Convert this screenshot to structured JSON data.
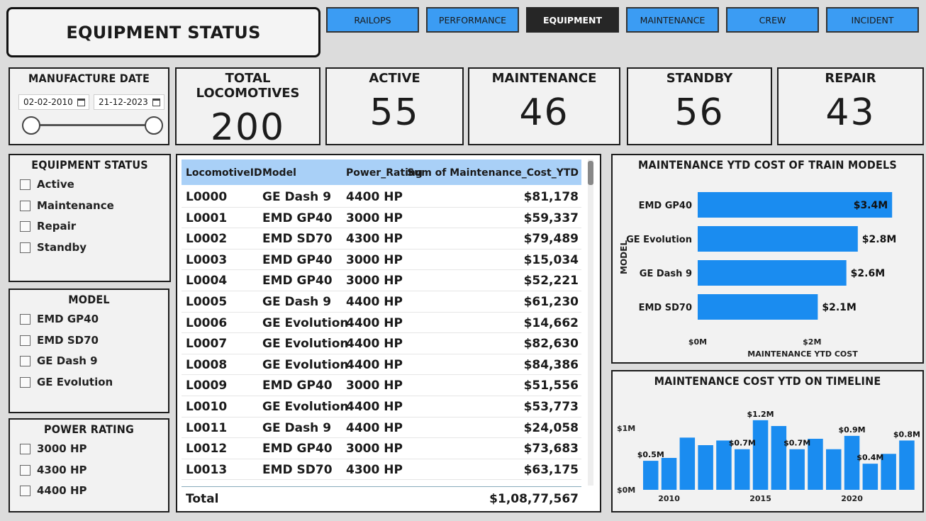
{
  "header": {
    "title": "EQUIPMENT STATUS"
  },
  "nav": [
    {
      "label": "RAILOPS",
      "active": false
    },
    {
      "label": "PERFORMANCE",
      "active": false
    },
    {
      "label": "EQUIPMENT",
      "active": true
    },
    {
      "label": "MAINTENANCE",
      "active": false
    },
    {
      "label": "CREW",
      "active": false
    },
    {
      "label": "INCIDENT",
      "active": false
    }
  ],
  "date_filter": {
    "title": "MANUFACTURE DATE",
    "start": "02-02-2010",
    "end": "21-12-2023"
  },
  "kpis": [
    {
      "label": "TOTAL LOCOMOTIVES",
      "value": "200"
    },
    {
      "label": "ACTIVE",
      "value": "55"
    },
    {
      "label": "MAINTENANCE",
      "value": "46"
    },
    {
      "label": "STANDBY",
      "value": "56"
    },
    {
      "label": "REPAIR",
      "value": "43"
    }
  ],
  "filters": {
    "status": {
      "title": "EQUIPMENT STATUS",
      "options": [
        "Active",
        "Maintenance",
        "Repair",
        "Standby"
      ]
    },
    "model": {
      "title": "MODEL",
      "options": [
        "EMD GP40",
        "EMD SD70",
        "GE Dash 9",
        "GE Evolution"
      ]
    },
    "power": {
      "title": "POWER RATING",
      "options": [
        "3000 HP",
        "4300 HP",
        "4400 HP"
      ]
    }
  },
  "table": {
    "columns": [
      "LocomotiveID",
      "Model",
      "Power_Rating",
      "Sum of Maintenance_Cost_YTD"
    ],
    "rows": [
      [
        "L0000",
        "GE Dash 9",
        "4400 HP",
        "$81,178"
      ],
      [
        "L0001",
        "EMD GP40",
        "3000 HP",
        "$59,337"
      ],
      [
        "L0002",
        "EMD SD70",
        "4300 HP",
        "$79,489"
      ],
      [
        "L0003",
        "EMD GP40",
        "3000 HP",
        "$15,034"
      ],
      [
        "L0004",
        "EMD GP40",
        "3000 HP",
        "$52,221"
      ],
      [
        "L0005",
        "GE Dash 9",
        "4400 HP",
        "$61,230"
      ],
      [
        "L0006",
        "GE Evolution",
        "4400 HP",
        "$14,662"
      ],
      [
        "L0007",
        "GE Evolution",
        "4400 HP",
        "$82,630"
      ],
      [
        "L0008",
        "GE Evolution",
        "4400 HP",
        "$84,386"
      ],
      [
        "L0009",
        "EMD GP40",
        "3000 HP",
        "$51,556"
      ],
      [
        "L0010",
        "GE Evolution",
        "4400 HP",
        "$53,773"
      ],
      [
        "L0011",
        "GE Dash 9",
        "4400 HP",
        "$24,058"
      ],
      [
        "L0012",
        "EMD GP40",
        "3000 HP",
        "$73,683"
      ],
      [
        "L0013",
        "EMD SD70",
        "4300 HP",
        "$63,175"
      ]
    ],
    "total_label": "Total",
    "total_value": "$1,08,77,567"
  },
  "colors": {
    "accent": "#1a8cf0",
    "nav": "#3b9cf3",
    "nav_active": "#262626",
    "table_header": "#a9d0f7"
  },
  "chart_data": [
    {
      "type": "bar",
      "orientation": "horizontal",
      "title": "MAINTENANCE YTD COST OF TRAIN MODELS",
      "xlabel": "MAINTENANCE YTD COST",
      "ylabel": "MODEL",
      "categories": [
        "EMD GP40",
        "GE Evolution",
        "GE Dash 9",
        "EMD SD70"
      ],
      "values": [
        3.4,
        2.8,
        2.6,
        2.1
      ],
      "value_labels": [
        "$3.4M",
        "$2.8M",
        "$2.6M",
        "$2.1M"
      ],
      "xticks": [
        "$0M",
        "$2M"
      ],
      "xlim": [
        0,
        3.5
      ],
      "unit": "$M"
    },
    {
      "type": "bar",
      "title": "MAINTENANCE COST YTD ON TIMELINE",
      "x": [
        2009,
        2010,
        2011,
        2012,
        2013,
        2014,
        2015,
        2016,
        2017,
        2018,
        2019,
        2020,
        2021,
        2022,
        2023
      ],
      "values": [
        0.5,
        0.55,
        0.9,
        0.77,
        0.85,
        0.7,
        1.2,
        1.1,
        0.7,
        0.88,
        0.7,
        0.93,
        0.45,
        0.62,
        0.85
      ],
      "value_labels": [
        {
          "index": 0,
          "text": "$0.5M"
        },
        {
          "index": 5,
          "text": "$0.7M"
        },
        {
          "index": 6,
          "text": "$1.2M"
        },
        {
          "index": 8,
          "text": "$0.7M"
        },
        {
          "index": 11,
          "text": "$0.9M"
        },
        {
          "index": 12,
          "text": "$0.4M"
        },
        {
          "index": 14,
          "text": "$0.8M"
        }
      ],
      "xticks": [
        "2010",
        "2015",
        "2020"
      ],
      "yticks": [
        "$0M",
        "$1M"
      ],
      "ylim": [
        0,
        1.35
      ]
    }
  ]
}
